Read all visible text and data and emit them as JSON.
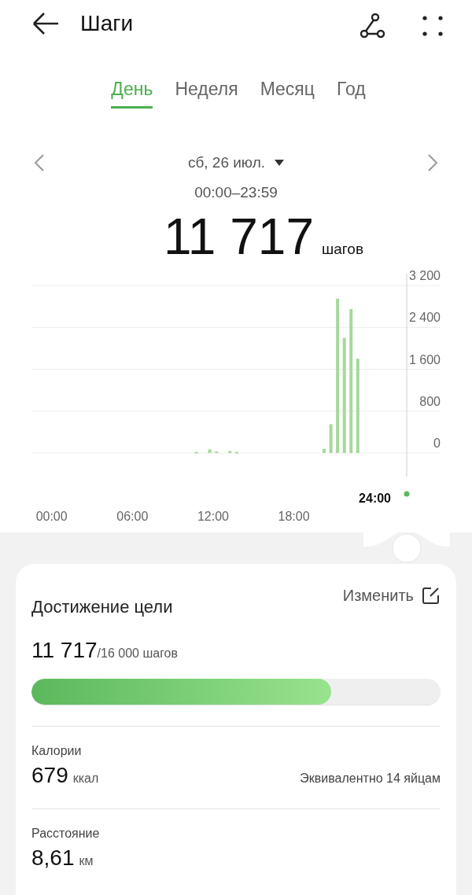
{
  "header": {
    "title": "Шаги"
  },
  "tabs": [
    {
      "label": "День",
      "selected": true
    },
    {
      "label": "Неделя",
      "selected": false
    },
    {
      "label": "Месяц",
      "selected": false
    },
    {
      "label": "Год",
      "selected": false
    }
  ],
  "date": {
    "label": "сб, 26 июл.",
    "range": "00:00–23:59"
  },
  "total": {
    "value": "11 717",
    "unit": "шагов"
  },
  "chart": {
    "cursor_label": "24:00",
    "chart_data": {
      "type": "bar",
      "x": [
        10.75,
        11.75,
        12.25,
        13.25,
        13.75,
        20.25,
        20.75,
        21.25,
        21.75,
        22.25,
        22.75
      ],
      "values": [
        20,
        70,
        30,
        40,
        20,
        80,
        550,
        2950,
        2200,
        2750,
        1800
      ],
      "color": "#a5d99b",
      "grid": true,
      "xlim": [
        -1.5,
        28.9
      ],
      "ylim": [
        0,
        3200
      ],
      "yticks": [
        {
          "value": 0,
          "label": "0"
        },
        {
          "value": 800,
          "label": "800"
        },
        {
          "value": 1600,
          "label": "1 600"
        },
        {
          "value": 2400,
          "label": "2 400"
        },
        {
          "value": 3200,
          "label": "3 200"
        }
      ],
      "xticks": [
        {
          "value": 0,
          "label": "00:00"
        },
        {
          "value": 6,
          "label": "06:00"
        },
        {
          "value": 12,
          "label": "12:00"
        },
        {
          "value": 18,
          "label": "18:00"
        }
      ]
    }
  },
  "goal": {
    "title": "Достижение цели",
    "edit_label": "Изменить",
    "value": "11 717",
    "target": "/16 000 шагов",
    "level": 0.732
  },
  "stats": [
    {
      "label": "Калории",
      "value": "679",
      "unit": "ккал",
      "note": "Эквивалентно 14 яйцам"
    },
    {
      "label": "Расстояние",
      "value": "8,61",
      "unit": "км"
    }
  ]
}
